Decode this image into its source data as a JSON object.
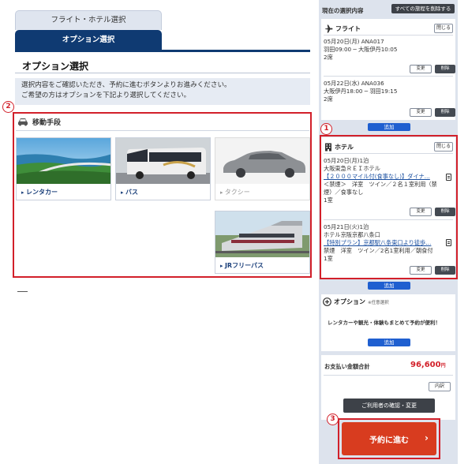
{
  "tabs": {
    "flight_hotel": "フライト・ホテル選択",
    "option": "オプション選択"
  },
  "page": {
    "title": "オプション選択",
    "instruction_line1": "選択内容をご確認いただき、予約に進むボタンよりお進みください。",
    "instruction_line2": "ご希望の方はオプションを下記より選択してください。"
  },
  "badges": {
    "one": "1",
    "two": "2",
    "three": "3"
  },
  "transport": {
    "heading": "移動手段",
    "cards": [
      {
        "label": "レンタカー"
      },
      {
        "label": "バス"
      },
      {
        "label": "タクシー"
      },
      {
        "label": "JRフリーパス"
      }
    ]
  },
  "sidebar": {
    "current_label": "現在の選択内容",
    "clear_all": "すべての旅程を削除する",
    "flight": {
      "title": "フライト",
      "close": "閉じる",
      "seg1": {
        "line1": "05月20日(月) ANA017",
        "line2": "羽田09:00 ─ 大阪伊丹10:05",
        "line3": "2席"
      },
      "seg2": {
        "line1": "05月22日(水) ANA036",
        "line2": "大阪伊丹18:00 ─ 羽田19:15",
        "line3": "2席"
      },
      "change": "変更",
      "delete": "削除",
      "add": "追加"
    },
    "hotel": {
      "title": "ホテル",
      "close": "閉じる",
      "h1": {
        "line1": "05月20日(月)1泊",
        "line2": "大阪東急ＲＥＩホテル",
        "line3": "【２０００マイル付(食事なし)】ダイナ…",
        "line4": "＜禁煙＞　洋室　ツイン／２名１室利用（禁",
        "line5": "煙）／食事なし",
        "line6": "1室"
      },
      "h2": {
        "line1": "05月21日(火)1泊",
        "line2": "ホテル京阪京都八条口",
        "line3": "【特別プラン】京都駅八条東口より徒歩…",
        "line4": "禁煙　洋室　ツイン／2名1室利用／朝食付",
        "line5": "1室"
      },
      "change": "変更",
      "delete": "削除",
      "add": "追加"
    },
    "option": {
      "title": "オプション",
      "note": "※任意選択",
      "promo": "レンタカーや観光・体験もまとめて予約が便利！",
      "add": "追加"
    },
    "payment": {
      "label": "お支払い金額合計",
      "amount": "96,600",
      "unit": "円",
      "details": "内訳",
      "confirm_users": "ご利用者の確認・変更"
    },
    "reserve": "予約に進む"
  },
  "colors": {
    "navy": "#0f3a72",
    "accent_red": "#d2202a",
    "reserve_orange": "#d83c1f",
    "link_blue": "#1f5fd0"
  }
}
